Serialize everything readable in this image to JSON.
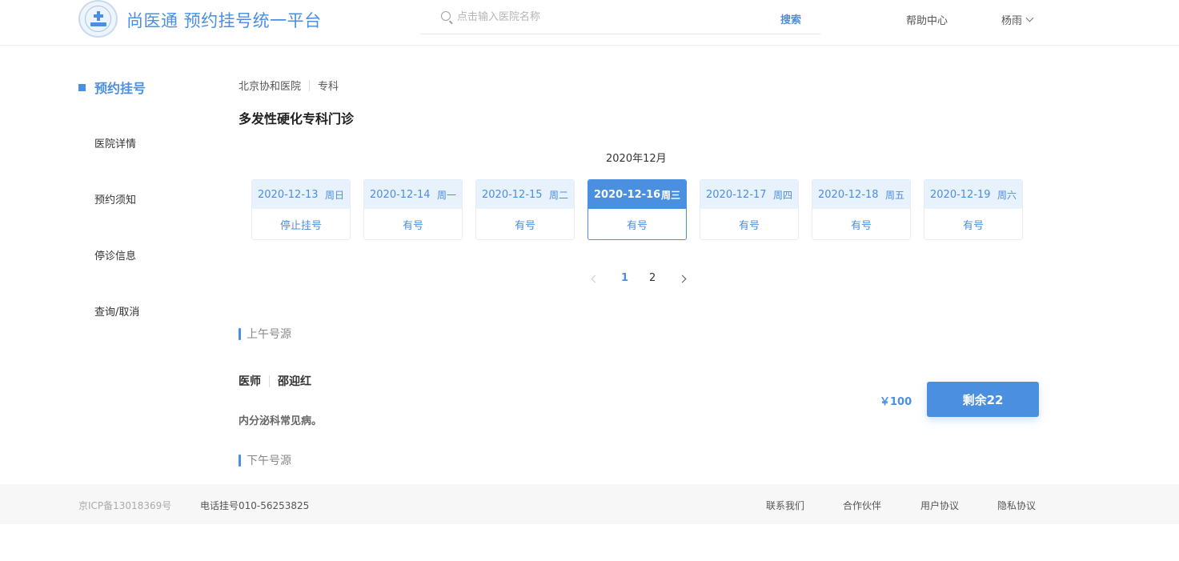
{
  "header": {
    "logo_text": "尚医通",
    "site_title": "尚医通 预约挂号统一平台",
    "search_placeholder": "点击输入医院名称",
    "search_button": "搜索",
    "help": "帮助中心",
    "user": "杨雨"
  },
  "sidebar": {
    "active": "预约挂号",
    "items": [
      "医院详情",
      "预约须知",
      "停诊信息",
      "查询/取消"
    ]
  },
  "breadcrumb": {
    "hospital": "北京协和医院",
    "category": "专科"
  },
  "department_title": "多发性硬化专科门诊",
  "month": "2020年12月",
  "dates": [
    {
      "date": "2020-12-13",
      "week": "周日",
      "status": "停止挂号",
      "active": false
    },
    {
      "date": "2020-12-14",
      "week": "周一",
      "status": "有号",
      "active": false
    },
    {
      "date": "2020-12-15",
      "week": "周二",
      "status": "有号",
      "active": false
    },
    {
      "date": "2020-12-16",
      "week": "周三",
      "status": "有号",
      "active": true
    },
    {
      "date": "2020-12-17",
      "week": "周四",
      "status": "有号",
      "active": false
    },
    {
      "date": "2020-12-18",
      "week": "周五",
      "status": "有号",
      "active": false
    },
    {
      "date": "2020-12-19",
      "week": "周六",
      "status": "有号",
      "active": false
    }
  ],
  "pagination": {
    "pages": [
      "1",
      "2"
    ],
    "current": "1"
  },
  "morning": {
    "title": "上午号源",
    "doctor_label": "医师",
    "doctor_name": "邵迎红",
    "specialty": "内分泌科常见病。",
    "price": "￥100",
    "remain": "剩余22"
  },
  "afternoon": {
    "title": "下午号源"
  },
  "footer": {
    "icp": "京ICP备13018369号",
    "phone": "电话挂号010-56253825",
    "links": [
      "联系我们",
      "合作伙伴",
      "用户协议",
      "隐私协议"
    ]
  },
  "colors": {
    "accent": "#4a8fe0",
    "light_accent": "#e8f2fd"
  }
}
